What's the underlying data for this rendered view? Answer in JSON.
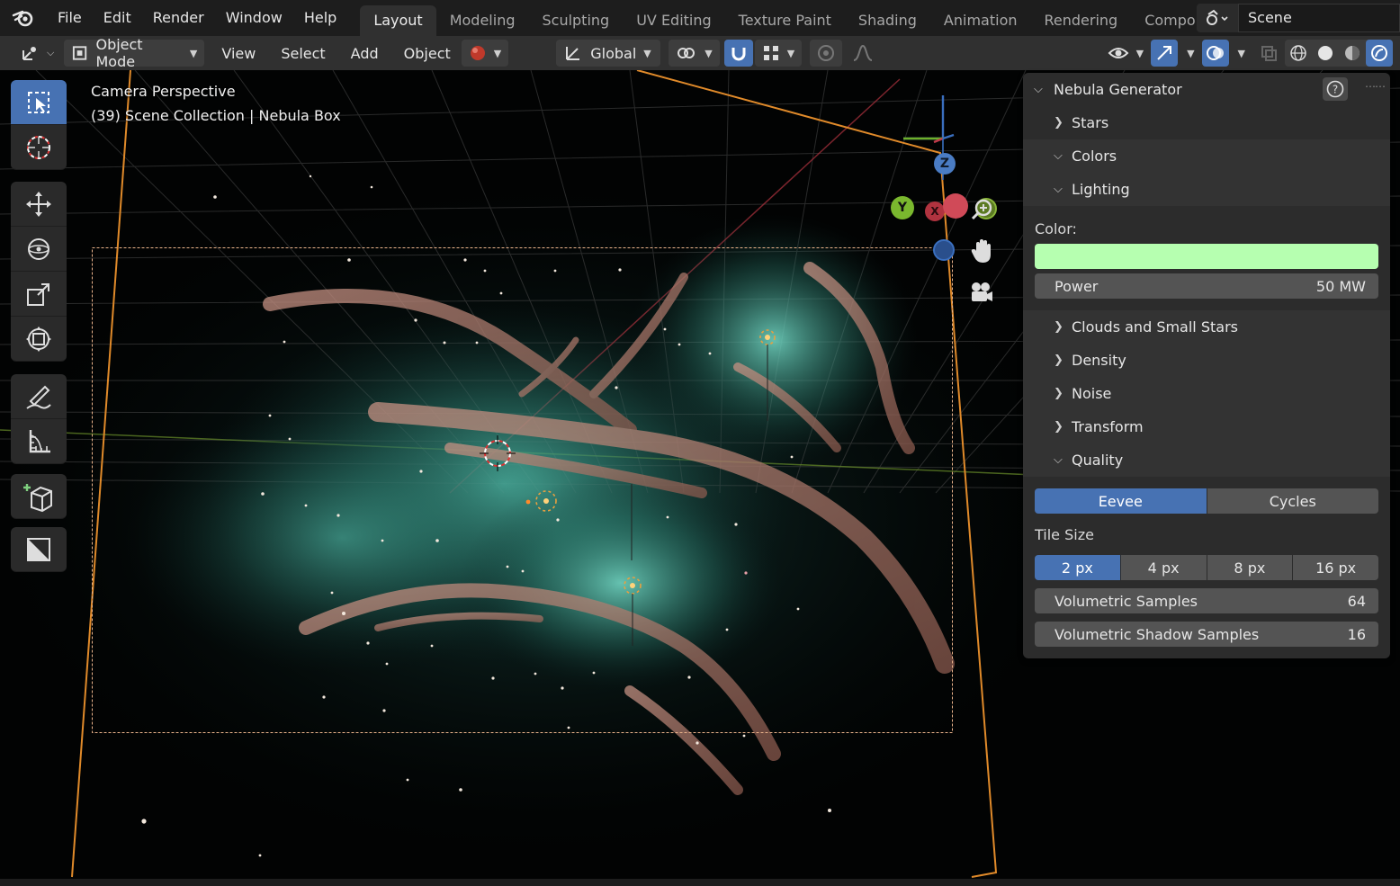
{
  "menu": {
    "items": [
      "File",
      "Edit",
      "Render",
      "Window",
      "Help"
    ]
  },
  "workspaces": {
    "tabs": [
      "Layout",
      "Modeling",
      "Sculpting",
      "UV Editing",
      "Texture Paint",
      "Shading",
      "Animation",
      "Rendering",
      "Compo"
    ],
    "active": "Layout"
  },
  "scene": {
    "name": "Scene"
  },
  "header": {
    "mode": "Object Mode",
    "menus": [
      "View",
      "Select",
      "Add",
      "Object"
    ],
    "orientation": "Global"
  },
  "viewport": {
    "camera_label": "Camera Perspective",
    "collection_label": "(39) Scene Collection | Nebula Box",
    "gizmo": {
      "z": "Z",
      "y": "Y",
      "x": "X"
    }
  },
  "panel": {
    "title": "Nebula Generator",
    "sections": {
      "stars": "Stars",
      "colors": "Colors",
      "lighting": "Lighting",
      "clouds": "Clouds and Small Stars",
      "density": "Density",
      "noise": "Noise",
      "transform": "Transform",
      "quality": "Quality"
    },
    "lighting": {
      "color_label": "Color:",
      "color_value": "#b6ffb0",
      "power_label": "Power",
      "power_value": "50 MW"
    },
    "quality": {
      "engines": [
        "Eevee",
        "Cycles"
      ],
      "active_engine": "Eevee",
      "tile_size_label": "Tile Size",
      "tile_sizes": [
        "2 px",
        "4 px",
        "8 px",
        "16 px"
      ],
      "active_tile": "2 px",
      "vol_samples_label": "Volumetric Samples",
      "vol_samples_value": "64",
      "vol_shadow_label": "Volumetric Shadow Samples",
      "vol_shadow_value": "16"
    }
  },
  "colors": {
    "accent": "#4772b3",
    "camera_frame": "#e08a2a",
    "nebula_teal": "#2f7a6e",
    "nebula_dust": "#b07a68"
  }
}
